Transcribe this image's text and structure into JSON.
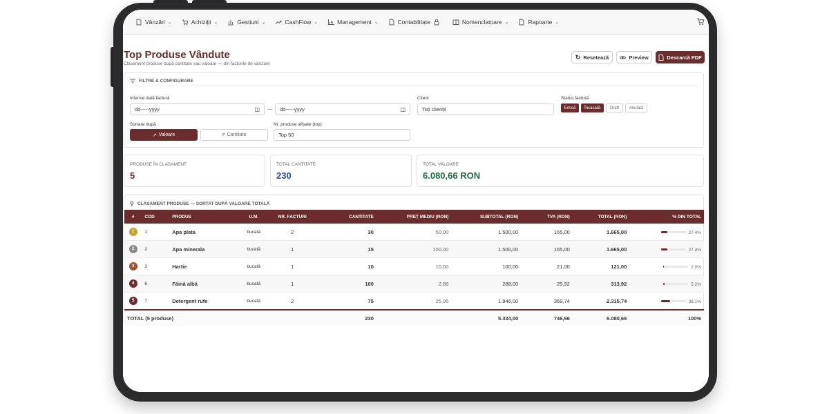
{
  "nav": {
    "items": [
      {
        "label": "Vânzări",
        "icon": "file-icon",
        "chevron": true
      },
      {
        "label": "Achiziții",
        "icon": "cart-icon",
        "chevron": true
      },
      {
        "label": "Gestiuni",
        "icon": "bar-chart-icon",
        "chevron": true
      },
      {
        "label": "CashFlow",
        "icon": "trend-icon",
        "chevron": true
      },
      {
        "label": "Management",
        "icon": "chart-icon",
        "chevron": true
      },
      {
        "label": "Contabilitate",
        "icon": "file-icon",
        "chevron": false,
        "lock": true
      },
      {
        "label": "Nomenclatoare",
        "icon": "book-icon",
        "chevron": true
      },
      {
        "label": "Rapoarte",
        "icon": "file-icon",
        "chevron": true
      }
    ]
  },
  "header": {
    "title": "Top Produse Vândute",
    "subtitle": "Clasament produse după cantitate sau valoare — din facturile de vânzare",
    "reset_label": "Resetează",
    "preview_label": "Preview",
    "download_label": "Descarcă PDF"
  },
  "filters": {
    "title": "FILTRE & CONFIGURARE",
    "date_label": "Interval dată factură",
    "date_from_placeholder": "dd-----yyyy",
    "date_sep": "—",
    "date_to_placeholder": "dd-----yyyy",
    "client_label": "Client",
    "client_value": "Toți clienții",
    "status_label": "Status factură",
    "status_options": [
      {
        "label": "Emisă",
        "active": true
      },
      {
        "label": "Încasată",
        "active": true
      },
      {
        "label": "Draft",
        "active": false
      },
      {
        "label": "Anulată",
        "active": false
      }
    ],
    "sort_label": "Sortare după",
    "sort_value_label": "Valoare",
    "sort_qty_label": "Cantitate",
    "top_label": "Nr. produse afișate (top)",
    "top_value": "Top 50"
  },
  "stats": {
    "products_label": "PRODUSE ÎN CLASAMENT",
    "products_value": "5",
    "qty_label": "TOTAL CANTITATE",
    "qty_value": "230",
    "value_label": "TOTAL VALOARE",
    "value_value": "6.080,66 RON"
  },
  "ranking": {
    "title": "CLASAMENT PRODUSE — SORTAT DUPĂ VALOARE TOTALĂ",
    "columns": [
      "#",
      "COD",
      "PRODUS",
      "U.M.",
      "NR. FACTURI",
      "CANTITATE",
      "PREȚ MEDIU (RON)",
      "SUBTOTAL (RON)",
      "TVA (RON)",
      "TOTAL (RON)",
      "% DIN TOTAL"
    ],
    "rows": [
      {
        "rank": "1",
        "rank_color": "#c9a227",
        "code": "1",
        "product": "Apa plata",
        "um": "bucată",
        "invoices": "2",
        "qty": "30",
        "avg": "50,00",
        "subtotal": "1.500,00",
        "vat": "165,00",
        "total": "1.665,00",
        "pct": "27.4%",
        "pct_value": 27.4
      },
      {
        "rank": "2",
        "rank_color": "#8a8a8a",
        "code": "2",
        "product": "Apa minerala",
        "um": "bucată",
        "invoices": "1",
        "qty": "15",
        "avg": "100,00",
        "subtotal": "1.500,00",
        "vat": "165,00",
        "total": "1.665,00",
        "pct": "27.4%",
        "pct_value": 27.4
      },
      {
        "rank": "3",
        "rank_color": "#a0522d",
        "code": "3",
        "product": "Hartie",
        "um": "bucată",
        "invoices": "1",
        "qty": "10",
        "avg": "10,00",
        "subtotal": "100,00",
        "vat": "21,00",
        "total": "121,00",
        "pct": "2.0%",
        "pct_value": 2.0
      },
      {
        "rank": "4",
        "rank_color": "#6b2c2c",
        "code": "6",
        "product": "Făină albă",
        "um": "bucată",
        "invoices": "1",
        "qty": "100",
        "avg": "2,88",
        "subtotal": "288,00",
        "vat": "25,92",
        "total": "313,92",
        "pct": "5.2%",
        "pct_value": 5.2
      },
      {
        "rank": "5",
        "rank_color": "#6b2c2c",
        "code": "7",
        "product": "Detergent rufe",
        "um": "bucată",
        "invoices": "2",
        "qty": "75",
        "avg": "25,95",
        "subtotal": "1.946,00",
        "vat": "369,74",
        "total": "2.315,74",
        "pct": "38.1%",
        "pct_value": 38.1
      }
    ],
    "footer": {
      "label": "TOTAL (5 produse)",
      "qty": "230",
      "subtotal": "5.334,00",
      "vat": "746,66",
      "total": "6.080,66",
      "pct": "100%"
    }
  }
}
